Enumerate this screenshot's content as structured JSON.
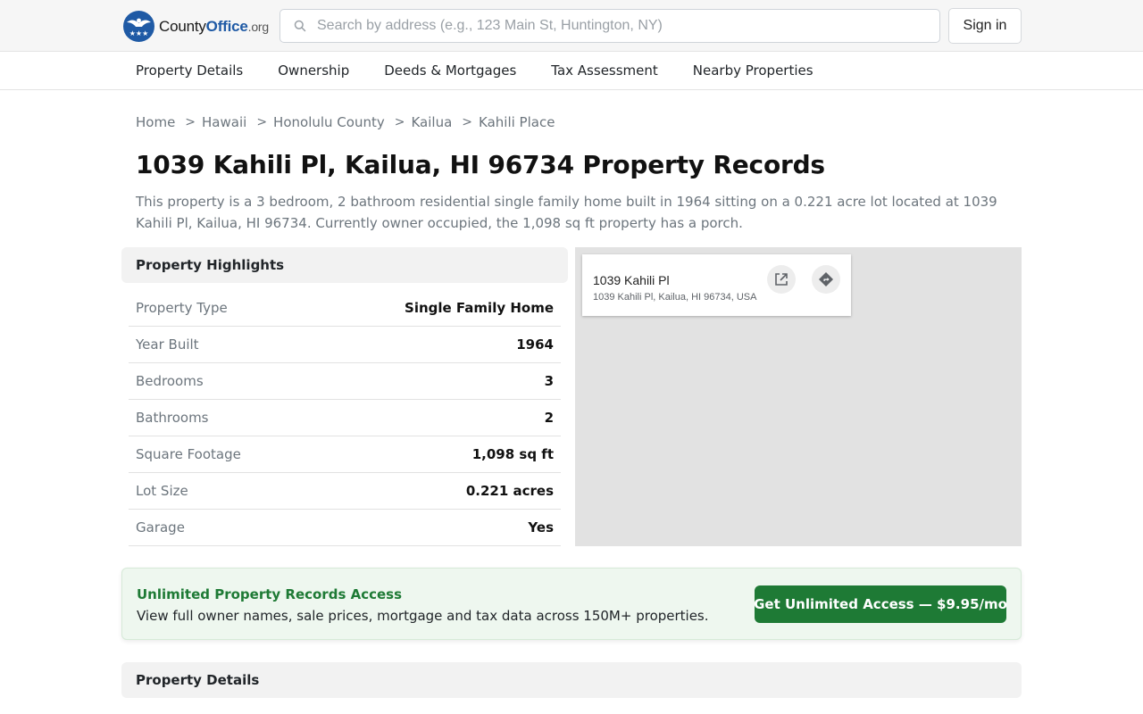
{
  "header": {
    "logo": {
      "part1": "County",
      "part2": "Office",
      "part3": ".org"
    },
    "search": {
      "placeholder": "Search by address (e.g., 123 Main St, Huntington, NY)",
      "value": ""
    },
    "signin_label": "Sign in"
  },
  "nav": {
    "items": [
      {
        "label": "Property Details"
      },
      {
        "label": "Ownership"
      },
      {
        "label": "Deeds & Mortgages"
      },
      {
        "label": "Tax Assessment"
      },
      {
        "label": "Nearby Properties"
      }
    ]
  },
  "breadcrumb": {
    "separator": ">",
    "items": [
      {
        "label": "Home"
      },
      {
        "label": "Hawaii"
      },
      {
        "label": "Honolulu County"
      },
      {
        "label": "Kailua"
      },
      {
        "label": "Kahili Place"
      }
    ]
  },
  "page": {
    "title": "1039 Kahili Pl, Kailua, HI 96734 Property Records",
    "description": "This property is a 3 bedroom, 2 bathroom residential single family home built in 1964 sitting on a 0.221 acre lot located at 1039 Kahili Pl, Kailua, HI 96734. Currently owner occupied, the 1,098 sq ft property has a porch."
  },
  "highlights": {
    "heading": "Property Highlights",
    "rows": [
      {
        "label": "Property Type",
        "value": "Single Family Home"
      },
      {
        "label": "Year Built",
        "value": "1964"
      },
      {
        "label": "Bedrooms",
        "value": "3"
      },
      {
        "label": "Bathrooms",
        "value": "2"
      },
      {
        "label": "Square Footage",
        "value": "1,098 sq ft"
      },
      {
        "label": "Lot Size",
        "value": "0.221 acres"
      },
      {
        "label": "Garage",
        "value": "Yes"
      }
    ]
  },
  "map": {
    "card_title": "1039 Kahili Pl",
    "card_subtitle": "1039 Kahili Pl, Kailua, HI 96734, USA",
    "icons": [
      "open-in-new-icon",
      "directions-icon"
    ]
  },
  "promo": {
    "title": "Unlimited Property Records Access",
    "text": "View full owner names, sale prices, mortgage and tax data across 150M+ properties.",
    "button_label": "Get Unlimited Access — $9.95/mo",
    "accent": "#1e7a35"
  },
  "details": {
    "heading": "Property Details"
  },
  "colors": {
    "brand": "#1f5aa5",
    "muted": "#6c757d",
    "success": "#1e7a35"
  }
}
